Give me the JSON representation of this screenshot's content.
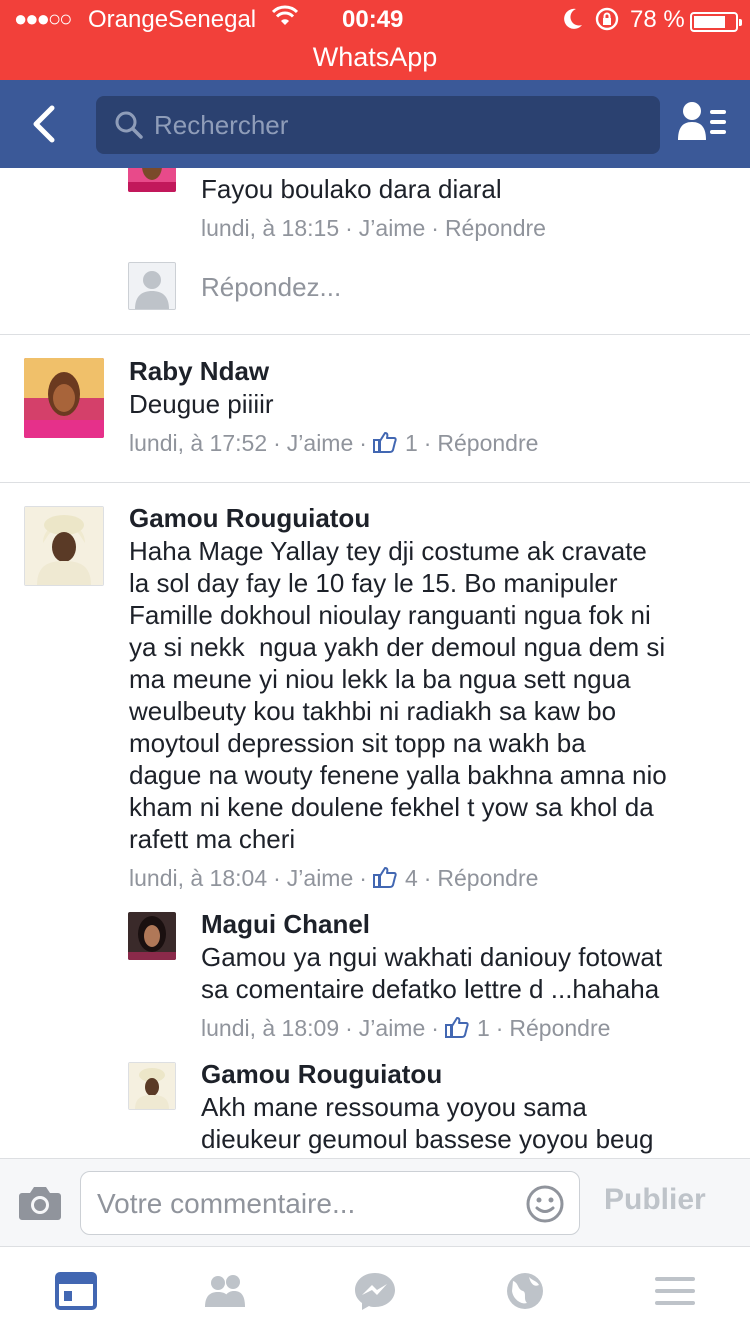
{
  "status_bar": {
    "signal": "●●●○○",
    "carrier": "OrangeSenegal",
    "time": "00:49",
    "battery_percent": "78 %",
    "battery_level": 0.78,
    "return_app": "WhatsApp"
  },
  "nav": {
    "search_placeholder": "Rechercher"
  },
  "thread": {
    "top_reply": {
      "text": "Fayou boulako dara diaral",
      "time": "lundi, à 18:15",
      "like": "J’aime",
      "reply": "Répondre"
    },
    "reply_input_placeholder": "Répondez...",
    "comments": [
      {
        "author": "Raby Ndaw",
        "text": "Deugue piiiir",
        "time": "lundi, à 17:52",
        "like": "J’aime",
        "like_count": "1",
        "reply": "Répondre"
      },
      {
        "author": "Gamou Rouguiatou",
        "lines": [
          "Haha Mage Yallay tey dji costume ak cravate",
          "la sol day fay le 10 fay le 15. Bo manipuler",
          "Famille dokhoul nioulay ranguanti ngua fok ni",
          "ya si nekk  ngua yakh der demoul ngua dem si",
          "ma meune yi niou lekk la ba ngua sett ngua",
          "weulbeuty kou takhbi ni radiakh sa kaw bo",
          "moytoul depression sit topp na wakh ba",
          "dague na wouty fenene yalla bakhna amna nio",
          "kham ni kene doulene fekhel t yow sa khol da",
          "rafett ma cheri"
        ],
        "time": "lundi, à 18:04",
        "like": "J’aime",
        "like_count": "4",
        "reply": "Répondre",
        "replies": [
          {
            "author": "Magui Chanel",
            "lines": [
              "Gamou ya ngui wakhati daniouy fotowat",
              "sa comentaire defatko lettre d ...hahaha"
            ],
            "time": "lundi, à 18:09",
            "like": "J’aime",
            "like_count": "1",
            "reply": "Répondre"
          },
          {
            "author": "Gamou Rouguiatou",
            "lines": [
              "Akh mane ressouma yoyou sama",
              "dieukeur geumoul bassese yoyou beug"
            ]
          }
        ]
      }
    ]
  },
  "composer": {
    "placeholder": "Votre commentaire...",
    "publish": "Publier"
  },
  "colors": {
    "status_bar": "#f2403a",
    "nav_bar": "#3b5998",
    "active_tab": "#4267b2",
    "inactive_tab": "#bec3c9"
  }
}
